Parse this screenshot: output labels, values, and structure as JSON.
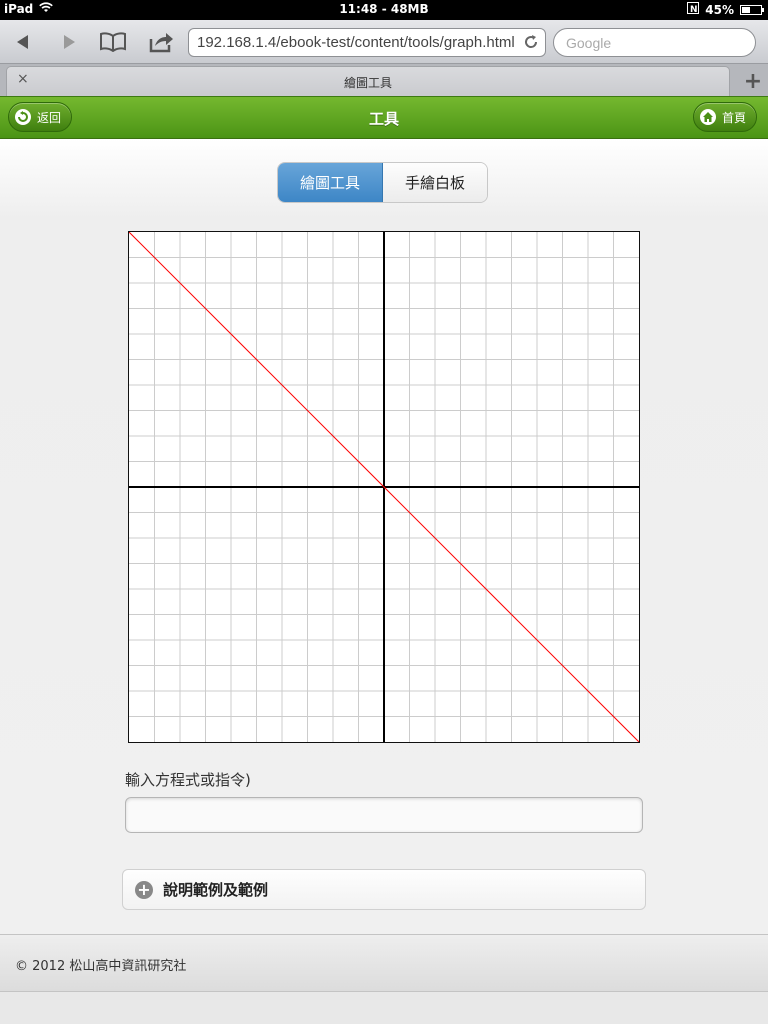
{
  "status_bar": {
    "device": "iPad",
    "time_memory": "11:48 - 48MB",
    "battery_percent": "45%",
    "battery_level": 0.45
  },
  "browser": {
    "url": "192.168.1.4/ebook-test/content/tools/graph.html",
    "search_placeholder": "Google",
    "tab_title": "繪圖工具",
    "tab_close": "×",
    "new_tab": "+"
  },
  "header": {
    "back_label": "返回",
    "title": "工具",
    "home_label": "首頁"
  },
  "segments": {
    "active": "繪圖工具",
    "inactive": "手繪白板"
  },
  "graph": {
    "grid_divisions": 20,
    "line_color": "#ff0000",
    "axis_color": "#000000",
    "grid_color": "#cccccc"
  },
  "chart_data": {
    "type": "line",
    "xlim": [
      -10,
      10
    ],
    "ylim": [
      -10,
      10
    ],
    "grid": true,
    "series": [
      {
        "x": [
          -10,
          10
        ],
        "y": [
          10,
          -10
        ],
        "color": "#ff0000"
      }
    ]
  },
  "form": {
    "input_label": "輸入方程式或指令)",
    "input_value": ""
  },
  "collapsible": {
    "label": "說明範例及範例"
  },
  "footer": {
    "copyright": "© 2012 松山高中資訊研究社"
  }
}
